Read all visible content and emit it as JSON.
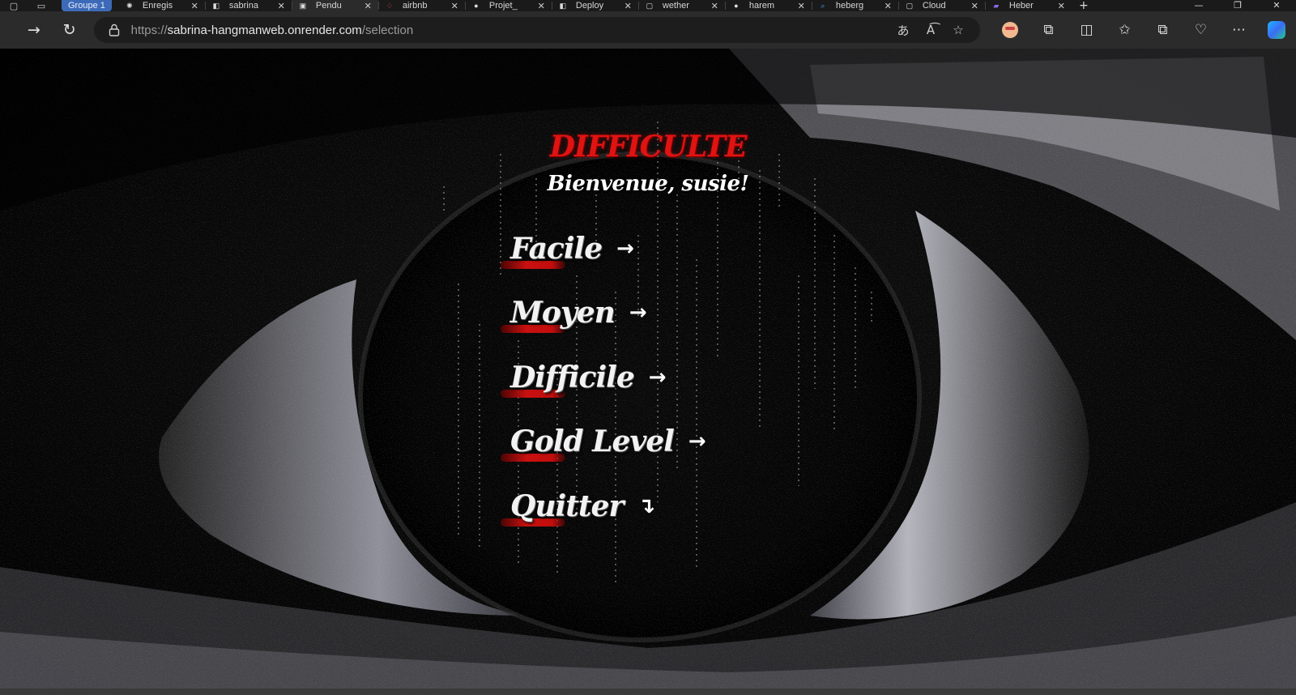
{
  "browser": {
    "tab_group_label": "Groupe 1",
    "tabs": [
      {
        "title": "Enregis",
        "icon": "openai-icon",
        "active": false
      },
      {
        "title": "sabrina",
        "icon": "render-icon",
        "active": false
      },
      {
        "title": "Pendu",
        "icon": "page-icon",
        "active": true
      },
      {
        "title": "airbnb",
        "icon": "airbnb-icon",
        "active": false
      },
      {
        "title": "Projet_",
        "icon": "github-icon",
        "active": false
      },
      {
        "title": "Deploy",
        "icon": "render-icon",
        "active": false
      },
      {
        "title": "wether",
        "icon": "page-icon",
        "active": false
      },
      {
        "title": "harem",
        "icon": "github-icon",
        "active": false
      },
      {
        "title": "heberg",
        "icon": "search-icon",
        "active": false
      },
      {
        "title": "Cloud",
        "icon": "page-icon",
        "active": false
      },
      {
        "title": "Heber",
        "icon": "heroku-icon",
        "active": false
      }
    ],
    "url_prefix": "https://",
    "url_host": "sabrina-hangmanweb.onrender.com",
    "url_path": "/selection"
  },
  "page": {
    "title": "DIFFICULTE",
    "welcome": "Bienvenue, susie!",
    "options": [
      {
        "label": "Facile",
        "arrow": "→"
      },
      {
        "label": "Moyen",
        "arrow": "→"
      },
      {
        "label": "Difficile",
        "arrow": "→"
      },
      {
        "label": "Gold Level",
        "arrow": "→"
      },
      {
        "label": "Quitter",
        "arrow": "↴"
      }
    ]
  },
  "colors": {
    "title_red": "#e01313",
    "swash_red": "#c91010",
    "text_white": "#f2f2f2",
    "background": "#000000"
  }
}
